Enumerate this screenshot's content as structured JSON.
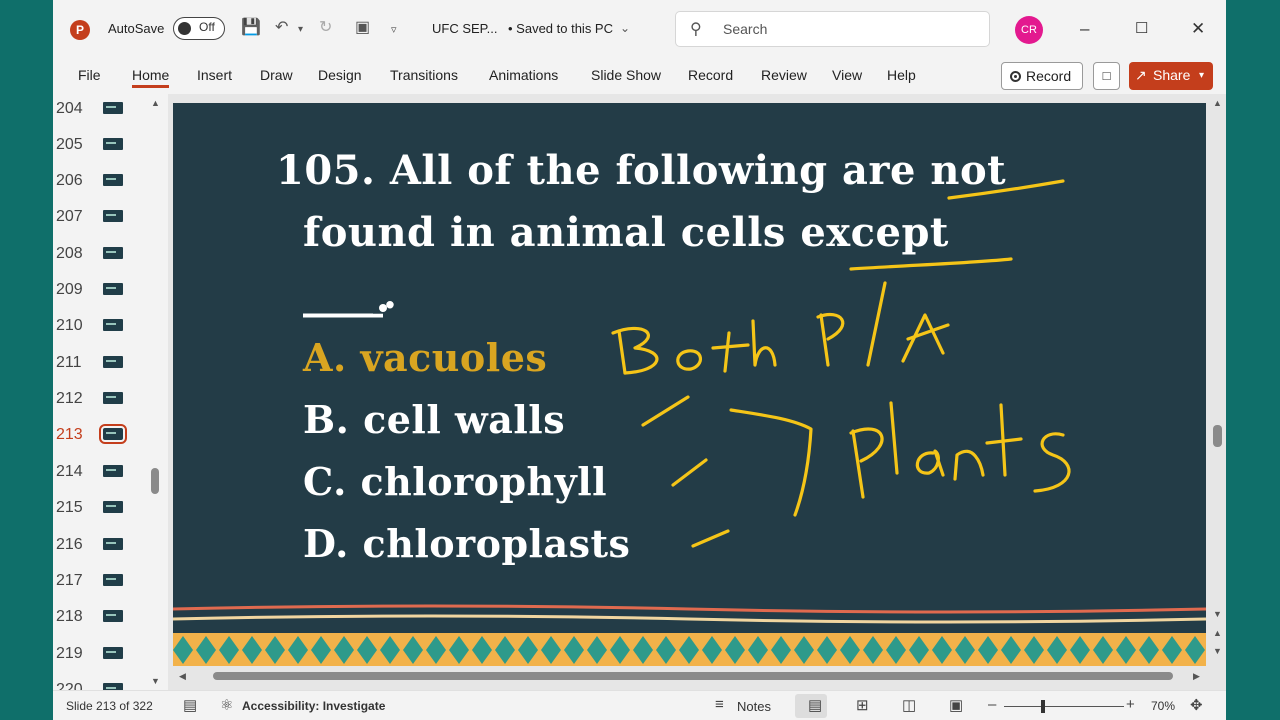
{
  "titlebar": {
    "autosave_label": "AutoSave",
    "autosave_state": "Off",
    "doc_title": "UFC SEP...",
    "save_status": "• Saved to this PC",
    "search_placeholder": "Search",
    "user_initials": "CR"
  },
  "ribbon": {
    "tabs": [
      "File",
      "Home",
      "Insert",
      "Draw",
      "Design",
      "Transitions",
      "Animations",
      "Slide Show",
      "Record",
      "Review",
      "View",
      "Help"
    ],
    "active_tab": "Home",
    "record_button": "Record",
    "share_button": "Share"
  },
  "thumbnails": {
    "numbers": [
      "204",
      "205",
      "206",
      "207",
      "208",
      "209",
      "210",
      "211",
      "212",
      "213",
      "214",
      "215",
      "216",
      "217",
      "218",
      "219",
      "220"
    ],
    "current": "213"
  },
  "slide": {
    "question_line1": "105. All of the following are not",
    "question_line2": "found in animal cells except",
    "blank": "____.",
    "options": [
      {
        "letter_text": "A. vacuoles",
        "highlight": true
      },
      {
        "letter_text": "B. cell walls",
        "highlight": false
      },
      {
        "letter_text": "C. chlorophyll",
        "highlight": false
      },
      {
        "letter_text": "D. chloroplasts",
        "highlight": false
      }
    ],
    "handwriting": [
      "Both P/A",
      "Plants"
    ],
    "colors": {
      "background": "#233c47",
      "answer": "#d9a521",
      "ink": "#f5c518"
    }
  },
  "statusbar": {
    "slide_info": "Slide 213 of 322",
    "accessibility": "Accessibility: Investigate",
    "notes": "Notes",
    "zoom": "70%"
  }
}
